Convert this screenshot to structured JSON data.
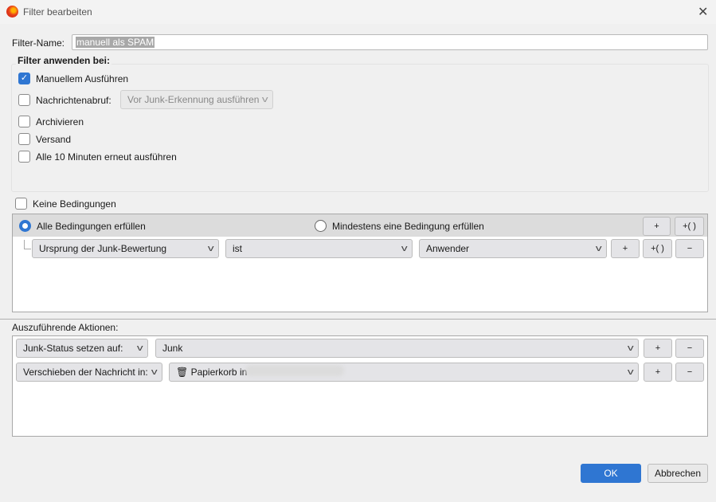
{
  "window": {
    "title": "Filter bearbeiten"
  },
  "filter_name": {
    "label": "Filter-Name:",
    "value": "manuell als SPAM"
  },
  "apply": {
    "heading": "Filter anwenden bei:",
    "manual": {
      "label": "Manuellem Ausführen",
      "checked": true
    },
    "fetch": {
      "label": "Nachrichtenabruf:",
      "checked": false,
      "dropdown": "Vor Junk-Erkennung ausführen"
    },
    "archive": {
      "label": "Archivieren",
      "checked": false
    },
    "send": {
      "label": "Versand",
      "checked": false
    },
    "periodic": {
      "label": "Alle 10 Minuten erneut ausführen",
      "checked": false
    }
  },
  "conditions": {
    "none_label": "Keine Bedingungen",
    "all_label": "Alle Bedingungen erfüllen",
    "any_label": "Mindestens eine Bedingung erfüllen",
    "rows": [
      {
        "field": "Ursprung der Junk-Bewertung",
        "op": "ist",
        "value": "Anwender"
      }
    ]
  },
  "buttons": {
    "plus": "+",
    "group": "+( )",
    "minus": "−",
    "ok": "OK",
    "cancel": "Abbrechen"
  },
  "actions": {
    "heading": "Auszuführende Aktionen:",
    "rows": [
      {
        "action": "Junk-Status setzen auf:",
        "target": "Junk"
      },
      {
        "action": "Verschieben der Nachricht in:",
        "target": "Papierkorb in"
      }
    ]
  }
}
